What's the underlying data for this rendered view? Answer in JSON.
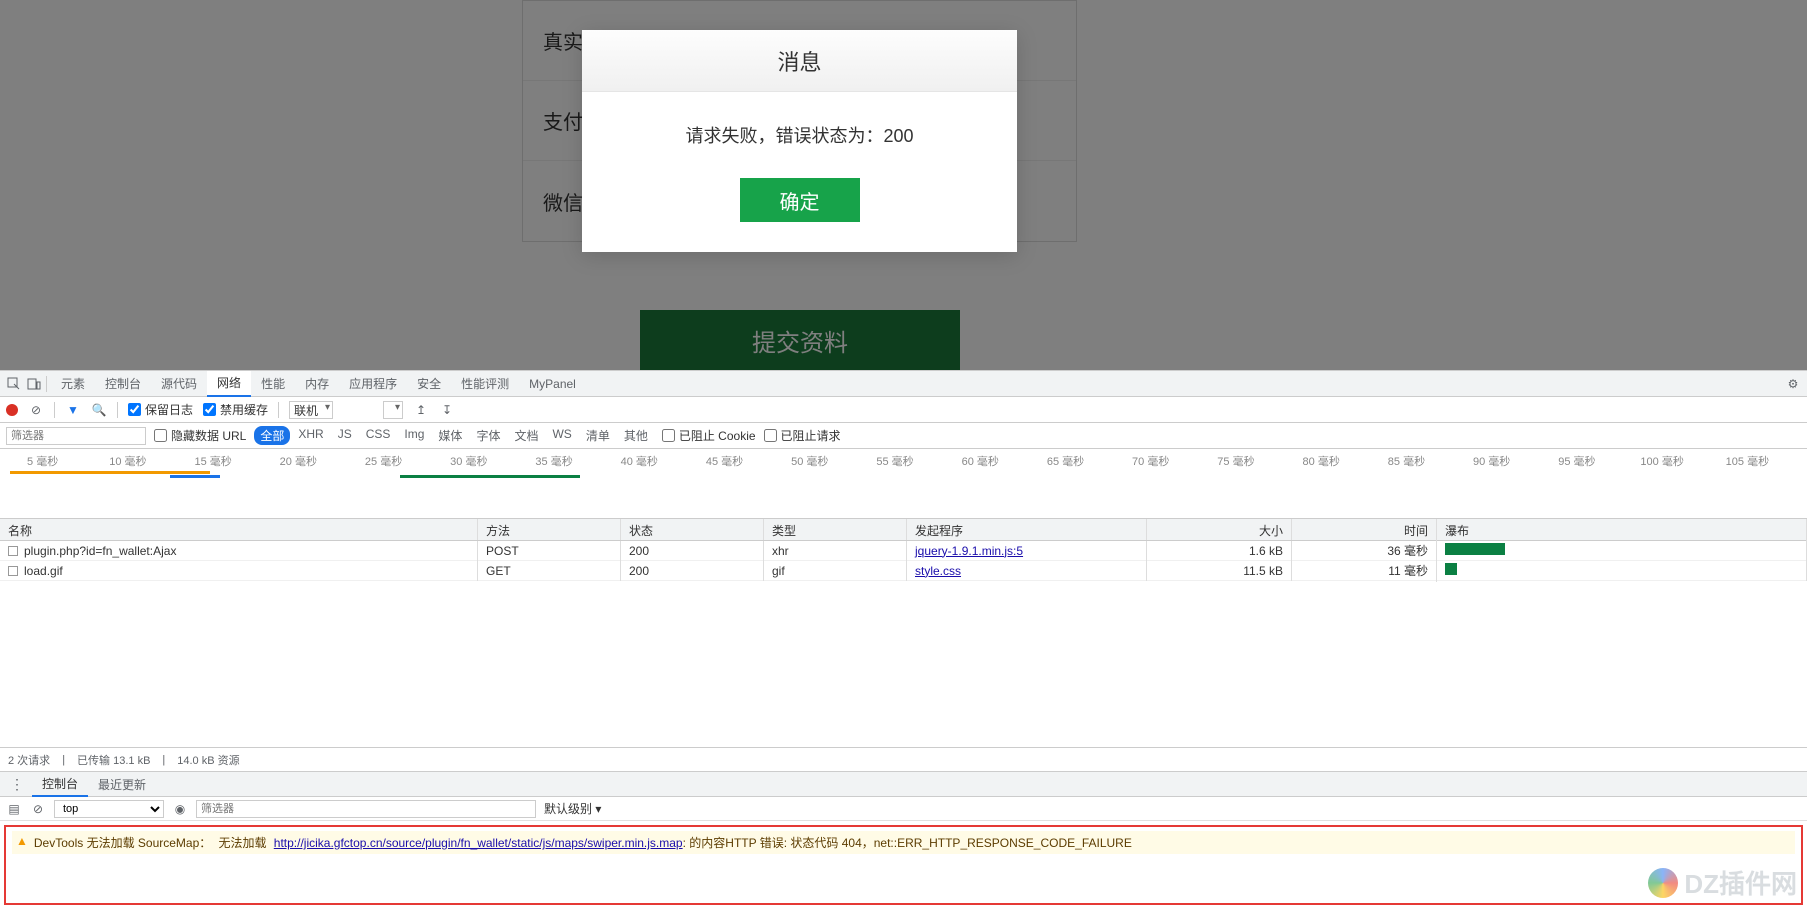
{
  "page": {
    "form_rows": [
      "真实",
      "支付",
      "微信"
    ],
    "submit_label": "提交资料"
  },
  "modal": {
    "title": "消息",
    "message": "请求失败，错误状态为：200",
    "ok_label": "确定"
  },
  "devtools": {
    "tabs": [
      "元素",
      "控制台",
      "源代码",
      "网络",
      "性能",
      "内存",
      "应用程序",
      "安全",
      "性能评测",
      "MyPanel"
    ],
    "active_tab_index": 3,
    "toolbar": {
      "preserve_log_label": "保留日志",
      "disable_cache_label": "禁用缓存",
      "throttle_label": "联机",
      "upload_icon": "↥",
      "download_icon": "↧"
    },
    "filter": {
      "placeholder": "筛选器",
      "hide_data_urls_label": "隐藏数据 URL",
      "types": [
        "全部",
        "XHR",
        "JS",
        "CSS",
        "Img",
        "媒体",
        "字体",
        "文档",
        "WS",
        "清单",
        "其他"
      ],
      "active_type_index": 0,
      "blocked_cookies_label": "已阻止 Cookie",
      "blocked_requests_label": "已阻止请求"
    },
    "timeline": {
      "ticks": [
        "5 毫秒",
        "10 毫秒",
        "15 毫秒",
        "20 毫秒",
        "25 毫秒",
        "30 毫秒",
        "35 毫秒",
        "40 毫秒",
        "45 毫秒",
        "50 毫秒",
        "55 毫秒",
        "60 毫秒",
        "65 毫秒",
        "70 毫秒",
        "75 毫秒",
        "80 毫秒",
        "85 毫秒",
        "90 毫秒",
        "95 毫秒",
        "100 毫秒",
        "105 毫秒"
      ]
    },
    "columns": {
      "name": "名称",
      "method": "方法",
      "status": "状态",
      "type": "类型",
      "initiator": "发起程序",
      "size": "大小",
      "time": "时间",
      "waterfall": "瀑布"
    },
    "rows": [
      {
        "name": "plugin.php?id=fn_wallet:Ajax",
        "method": "POST",
        "status": "200",
        "type": "xhr",
        "initiator": "jquery-1.9.1.min.js:5",
        "size": "1.6 kB",
        "time": "36 毫秒",
        "wf_left": 0,
        "wf_width": 60
      },
      {
        "name": "load.gif",
        "method": "GET",
        "status": "200",
        "type": "gif",
        "initiator": "style.css",
        "size": "11.5 kB",
        "time": "11 毫秒",
        "wf_left": 0,
        "wf_width": 12
      }
    ],
    "status_bar": {
      "requests": "2 次请求",
      "transferred": "已传输 13.1 kB",
      "resources": "14.0 kB 资源"
    },
    "drawer_tabs": [
      "控制台",
      "最近更新"
    ],
    "drawer_active_index": 0,
    "console": {
      "context": "top",
      "filter_placeholder": "筛选器",
      "levels_label": "默认级别 ▾",
      "warning": {
        "prefix": "DevTools 无法加载 SourceMap：",
        "mid": "无法加载",
        "url": "http://jicika.gfctop.cn/source/plugin/fn_wallet/static/js/maps/swiper.min.js.map",
        "suffix": ": 的内容HTTP 错误: 状态代码 404，net::ERR_HTTP_RESPONSE_CODE_FAILURE"
      }
    }
  },
  "watermark": "DZ插件网"
}
